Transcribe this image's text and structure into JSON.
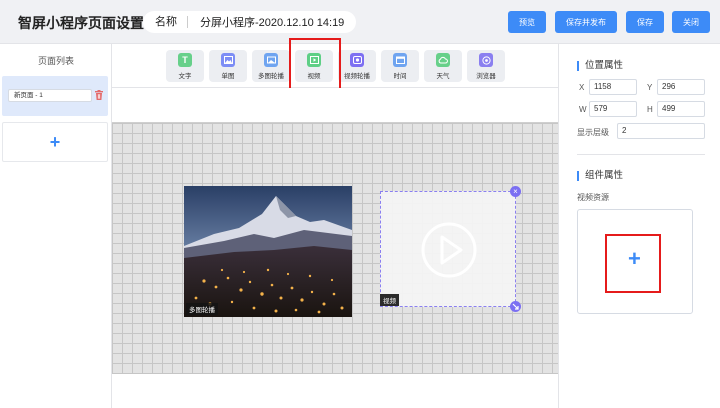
{
  "header": {
    "title": "智屏小程序页面设置",
    "name_label": "名称",
    "name_value": "分屏小程序-2020.12.10 14:19",
    "buttons": {
      "preview": "预览",
      "save_publish": "保存并发布",
      "save": "保存",
      "close": "关闭"
    }
  },
  "left_panel": {
    "heading": "页面列表",
    "pages": [
      {
        "name": "新页面 - 1"
      }
    ],
    "add_symbol": "+"
  },
  "toolbar": {
    "tools": [
      {
        "label": "文字",
        "icon": "text-icon",
        "glyph": "T",
        "color": "#67d08a"
      },
      {
        "label": "单图",
        "icon": "image-icon",
        "glyph": "",
        "color": "#7c8df5"
      },
      {
        "label": "多图轮播",
        "icon": "carousel-icon",
        "glyph": "",
        "color": "#6fa4f0"
      },
      {
        "label": "视频",
        "icon": "video-icon",
        "glyph": "",
        "color": "#5fcf86"
      },
      {
        "label": "视频轮播",
        "icon": "video-carousel-icon",
        "glyph": "",
        "color": "#7d6ff2"
      },
      {
        "label": "时间",
        "icon": "clock-icon",
        "glyph": "",
        "color": "#6fa4f0"
      },
      {
        "label": "天气",
        "icon": "weather-icon",
        "glyph": "",
        "color": "#67d08a"
      },
      {
        "label": "浏览器",
        "icon": "browser-icon",
        "glyph": "",
        "color": "#8a7ff0"
      }
    ]
  },
  "canvas": {
    "widgets": [
      {
        "type": "多图轮播",
        "tag": "多图轮播"
      },
      {
        "type": "视频",
        "tag": "视频"
      }
    ]
  },
  "right_panel": {
    "position_title": "位置属性",
    "x_label": "X",
    "x_value": "1158",
    "y_label": "Y",
    "y_value": "296",
    "w_label": "W",
    "w_value": "579",
    "h_label": "H",
    "h_value": "499",
    "layer_label": "显示层级",
    "layer_value": "2",
    "component_title": "组件属性",
    "video_source_label": "视频资源",
    "upload_symbol": "+"
  },
  "colors": {
    "accent": "#3d8bf7",
    "highlight": "#e51b1b",
    "selection": "#7b6ff2"
  }
}
